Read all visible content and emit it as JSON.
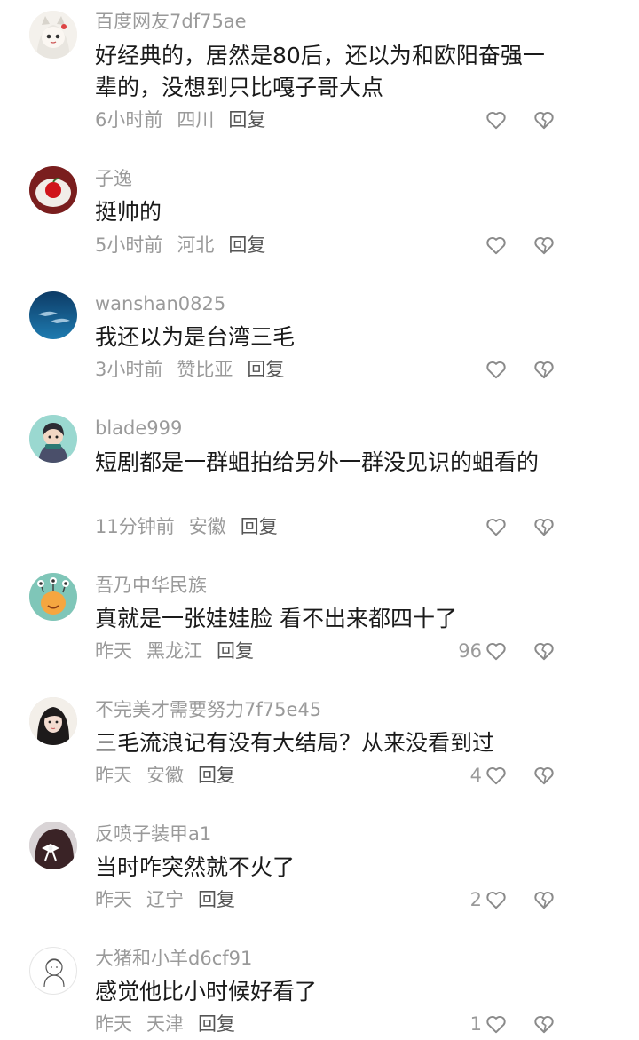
{
  "comments": [
    {
      "username": "百度网友7df75ae",
      "text": "好经典的，居然是80后，还以为和欧阳奋强一辈的，没想到只比嘎子哥大点",
      "time": "6小时前",
      "location": "四川",
      "reply": "回复",
      "likes": "",
      "avatar_icon": "anime-cat-girl-avatar-icon"
    },
    {
      "username": "子逸",
      "text": "挺帅的",
      "time": "5小时前",
      "location": "河北",
      "reply": "回复",
      "likes": "",
      "avatar_icon": "red-apple-avatar-icon"
    },
    {
      "username": "wanshan0825",
      "text": "我还以为是台湾三毛",
      "time": "3小时前",
      "location": "赞比亚",
      "reply": "回复",
      "likes": "",
      "avatar_icon": "dolphins-avatar-icon"
    },
    {
      "username": "blade999",
      "text": "短剧都是一群蛆拍给另外一群没见识的蛆看的",
      "time": "11分钟前",
      "location": "安徽",
      "reply": "回复",
      "likes": "",
      "avatar_icon": "cartoon-character-avatar-icon"
    },
    {
      "username": "吾乃中华民族",
      "text": "真就是一张娃娃脸 看不出来都四十了",
      "time": "昨天",
      "location": "黑龙江",
      "reply": "回复",
      "likes": "96",
      "avatar_icon": "monster-avatar-icon"
    },
    {
      "username": "不完美才需要努力7f75e45",
      "text": "三毛流浪记有没有大结局？从来没看到过",
      "time": "昨天",
      "location": "安徽",
      "reply": "回复",
      "likes": "4",
      "avatar_icon": "girl-portrait-avatar-icon"
    },
    {
      "username": "反喷子装甲a1",
      "text": "当时咋突然就不火了",
      "time": "昨天",
      "location": "辽宁",
      "reply": "回复",
      "likes": "2",
      "avatar_icon": "hair-bow-avatar-icon"
    },
    {
      "username": "大猪和小羊d6cf91",
      "text": "感觉他比小时候好看了",
      "time": "昨天",
      "location": "天津",
      "reply": "回复",
      "likes": "1",
      "avatar_icon": "line-sketch-avatar-icon"
    }
  ],
  "colors": {
    "meta": "#9a9a9a",
    "text": "#1a1a1a",
    "reply": "#555555",
    "icon": "#8a8a8a"
  }
}
